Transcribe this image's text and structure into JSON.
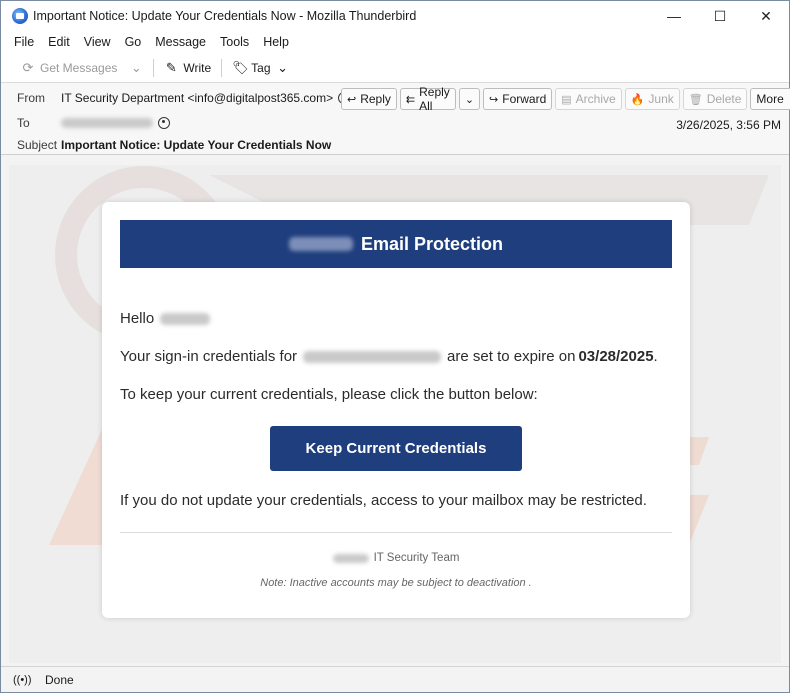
{
  "window": {
    "title": "Important Notice: Update Your Credentials Now - Mozilla Thunderbird",
    "controls": {
      "minimize": "—",
      "maximize": "☐",
      "close": "✕"
    }
  },
  "menu": [
    "File",
    "Edit",
    "View",
    "Go",
    "Message",
    "Tools",
    "Help"
  ],
  "toolbar": {
    "get_messages": "Get Messages",
    "write": "Write",
    "tag": "Tag"
  },
  "header": {
    "from_label": "From",
    "from_value": "IT Security Department <info@digitalpost365.com>",
    "to_label": "To",
    "subject_label": "Subject",
    "subject_value": "Important Notice: Update Your Credentials Now",
    "date": "3/26/2025, 3:56 PM",
    "actions": {
      "reply": "Reply",
      "reply_all": "Reply All",
      "forward": "Forward",
      "archive": "Archive",
      "junk": "Junk",
      "delete": "Delete",
      "more": "More"
    }
  },
  "email": {
    "banner_title": "Email Protection",
    "greeting": "Hello",
    "line1_prefix": "Your sign-in credentials for",
    "line1_suffix": "are set to expire on",
    "expiry_date": "03/28/2025",
    "line1_end": ".",
    "line2": "To keep your current credentials, please click the button below:",
    "button": "Keep Current Credentials",
    "line3": "If you do not update your credentials, access to your mailbox may be restricted.",
    "team": "IT Security Team",
    "note": "Note: Inactive accounts may be subject to deactivation ."
  },
  "status": {
    "text": "Done"
  },
  "colors": {
    "brand": "#1f3e7e",
    "watermark": "#e8dcd8"
  }
}
